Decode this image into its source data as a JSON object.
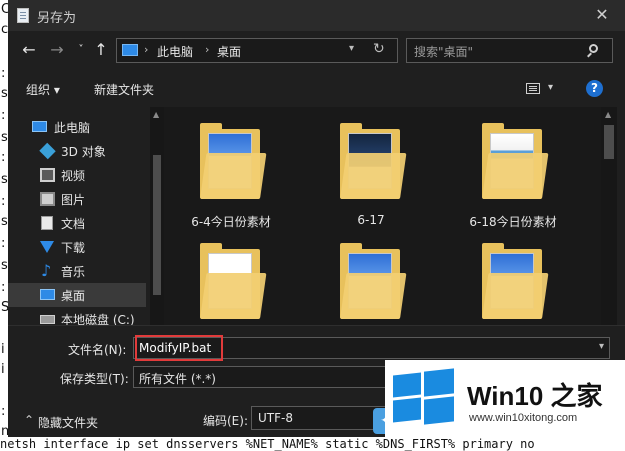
{
  "background": {
    "left_margin_chars": [
      "C",
      "c",
      ":",
      "s",
      ":",
      "s",
      ":",
      "s",
      ":",
      "s",
      ":",
      "s",
      ":",
      "S",
      "i",
      "i",
      ":",
      "n"
    ],
    "bottom_line": "netsh interface ip set dnsservers %NET_NAME% static %DNS_FIRST% primary no"
  },
  "window": {
    "title": "另存为"
  },
  "nav": {
    "back": "←",
    "forward": "→",
    "recent": "˅",
    "up": "↑",
    "breadcrumb": [
      "此电脑",
      "桌面"
    ],
    "crumb_sep": "›",
    "search_placeholder": "搜索\"桌面\""
  },
  "toolbar": {
    "organize": "组织 ▾",
    "new_folder": "新建文件夹"
  },
  "sidebar": {
    "items": [
      {
        "label": "此电脑",
        "icon": "computer-icon"
      },
      {
        "label": "3D 对象",
        "icon": "3d-objects-icon"
      },
      {
        "label": "视频",
        "icon": "video-icon"
      },
      {
        "label": "图片",
        "icon": "pictures-icon"
      },
      {
        "label": "文档",
        "icon": "documents-icon"
      },
      {
        "label": "下载",
        "icon": "downloads-icon"
      },
      {
        "label": "音乐",
        "icon": "music-icon"
      },
      {
        "label": "桌面",
        "icon": "desktop-icon"
      },
      {
        "label": "本地磁盘 (C:)",
        "icon": "drive-icon"
      }
    ],
    "selected_index": 7
  },
  "files": [
    {
      "label": "6-4今日份素材",
      "thumb": "blue"
    },
    {
      "label": "6-17",
      "thumb": "dark"
    },
    {
      "label": "6-18今日份素材",
      "thumb": "shot"
    },
    {
      "label": "",
      "thumb": "doc"
    },
    {
      "label": "",
      "thumb": "blue"
    },
    {
      "label": "",
      "thumb": "blue"
    }
  ],
  "form": {
    "filename_label": "文件名(N):",
    "filename_value": "ModifyIP.bat",
    "filetype_label": "保存类型(T):",
    "filetype_value": "所有文件  (*.*)",
    "hide_folders": "隐藏文件夹",
    "encoding_label": "编码(E):",
    "encoding_value": "UTF-8"
  },
  "watermark": {
    "title": "Win10 之家",
    "url": "www.win10xitong.com"
  },
  "colors": {
    "accent": "#2e8ae6",
    "highlight": "#e23b3b",
    "folder": "#e8c15c"
  }
}
